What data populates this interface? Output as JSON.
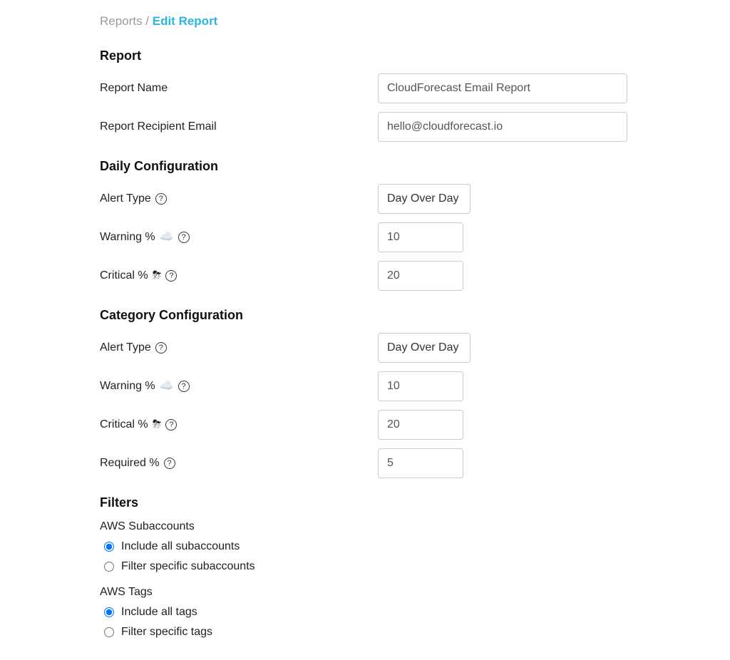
{
  "breadcrumb": {
    "parent": "Reports",
    "sep": "/",
    "current": "Edit Report"
  },
  "sections": {
    "report": {
      "heading": "Report",
      "name_label": "Report Name",
      "name_value": "CloudForecast Email Report",
      "email_label": "Report Recipient Email",
      "email_value": "hello@cloudforecast.io"
    },
    "daily": {
      "heading": "Daily Configuration",
      "alert_type_label": "Alert Type",
      "alert_type_value": "Day Over Day",
      "warning_label": "Warning %",
      "warning_icon": "☁️",
      "warning_value": "10",
      "critical_label": "Critical %",
      "critical_icon": "⛈",
      "critical_value": "20"
    },
    "category": {
      "heading": "Category Configuration",
      "alert_type_label": "Alert Type",
      "alert_type_value": "Day Over Day",
      "warning_label": "Warning %",
      "warning_icon": "☁️",
      "warning_value": "10",
      "critical_label": "Critical %",
      "critical_icon": "⛈",
      "critical_value": "20",
      "required_label": "Required %",
      "required_value": "5"
    },
    "filters": {
      "heading": "Filters",
      "subaccounts_label": "AWS Subaccounts",
      "subaccounts_options": {
        "include_all": "Include all subaccounts",
        "filter_specific": "Filter specific subaccounts"
      },
      "subaccounts_selected": "include_all",
      "tags_label": "AWS Tags",
      "tags_options": {
        "include_all": "Include all tags",
        "filter_specific": "Filter specific tags"
      },
      "tags_selected": "include_all"
    }
  }
}
